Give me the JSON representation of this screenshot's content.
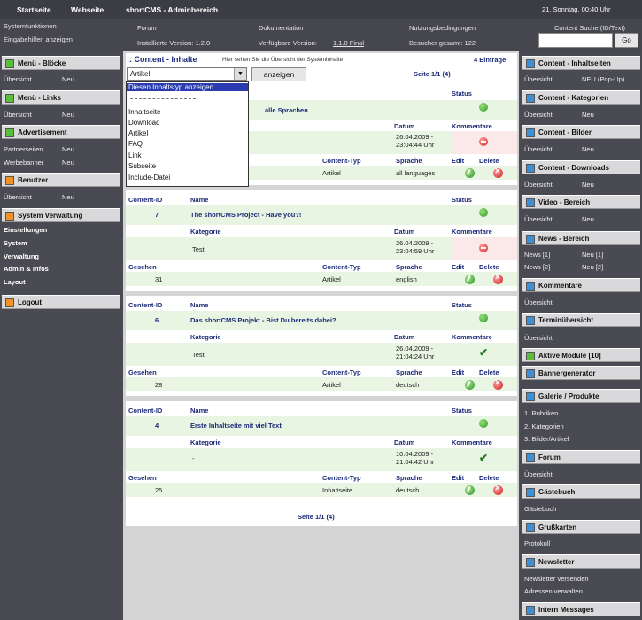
{
  "topbar": {
    "nav": [
      "Startseite",
      "Webseite"
    ],
    "title": "shortCMS - Adminbereich",
    "datetime": "21. Sonntag, 00:40 Uhr"
  },
  "subbar": {
    "systemfunktionen": "Systemfunktionen",
    "eingabehilfen": "Eingabehilfen anzeigen",
    "forum": "Forum",
    "installed_version": "Installierte Version: 1.2.0",
    "documentation": "Dokumentation",
    "available_version_label": "Verfügbare Version:",
    "available_version_value": "1.1.0 Final",
    "terms": "Nutzungsbedingungen",
    "visitors": "Besucher gesamt: 122",
    "search_label": "Content Suche (ID/Text)",
    "go": "Go"
  },
  "left_sidebar": {
    "blocks": [
      {
        "title": "Menü - Blöcke",
        "icon": "green-square-icon",
        "links": [
          "Übersicht",
          "Neu"
        ]
      },
      {
        "title": "Menü - Links",
        "icon": "green-square-icon",
        "links": [
          "Übersicht",
          "Neu"
        ]
      },
      {
        "title": "Advertisement",
        "icon": "green-square-icon",
        "links": [
          "Partnerseiten",
          "Neu",
          "Werbebanner",
          "Neu"
        ]
      },
      {
        "title": "Benutzer",
        "icon": "orange-square-icon",
        "links": [
          "Übersicht",
          "Neu"
        ]
      },
      {
        "title": "System Verwaltung",
        "icon": "orange-square-icon",
        "items": [
          "Einstellungen",
          "System",
          "Verwaltung",
          "Admin & Infos",
          "Layout"
        ]
      },
      {
        "title": "Logout",
        "icon": "orange-square-icon"
      }
    ]
  },
  "right_sidebar": {
    "blocks": [
      {
        "title": "Content - Inhaltseiten",
        "links": [
          "Übersicht",
          "NEU (Pop-Up)"
        ]
      },
      {
        "title": "Content - Kategorien",
        "links": [
          "Übersicht",
          "Neu"
        ]
      },
      {
        "title": "Content - Bilder",
        "links": [
          "Übersicht",
          "Neu"
        ]
      },
      {
        "title": "Content - Downloads",
        "links": [
          "Übersicht",
          "Neu"
        ]
      },
      {
        "title": "Video - Bereich",
        "links": [
          "Übersicht",
          "Neu"
        ]
      },
      {
        "title": "News - Bereich",
        "links": [
          "News [1]",
          "Neu [1]",
          "News [2]",
          "Neu [2]"
        ]
      },
      {
        "title": "Kommentare",
        "links": [
          "Übersicht"
        ]
      },
      {
        "title": "Terminübersicht",
        "links": [
          "Übersicht"
        ]
      },
      {
        "title": "Aktive Module [10]",
        "links": []
      },
      {
        "title": "Bannergenerator",
        "links": []
      },
      {
        "title": "Galerie / Produkte",
        "links": [
          "1. Rubriken",
          "2. Kategorien",
          "3. Bilder/Artikel"
        ]
      },
      {
        "title": "Forum",
        "links": [
          "Übersicht"
        ]
      },
      {
        "title": "Gästebuch",
        "links": [
          "Gästebuch"
        ]
      },
      {
        "title": "Grußkarten",
        "links": [
          "Protokoll"
        ]
      },
      {
        "title": "Newsletter",
        "links": [
          "Newsletter versenden",
          "Adressen verwalten"
        ]
      },
      {
        "title": "Intern Messages",
        "links": []
      }
    ]
  },
  "content": {
    "title": ":: Content - Inhalte",
    "subtitle": "Hier sehen Sie die Übersicht der Systeminhalte",
    "entries": "4 Einträge",
    "page_top": "Seite 1/1 (4)",
    "page_bottom": "Seite 1/1 (4)",
    "select_value": "Artikel",
    "show_button": "anzeigen",
    "dropdown_options": [
      "Diesen Inhaltstyp anzeigen",
      "Inhaltseite",
      "Download",
      "Artikel",
      "FAQ",
      "Link",
      "Subseite",
      "Include-Datei"
    ],
    "partial_name": "alle Sprachen",
    "headers": {
      "id": "Content-ID",
      "name": "Name",
      "status": "Status",
      "kategorie": "Kategorie",
      "datum": "Datum",
      "kommentare": "Kommentare",
      "gesehen": "Gesehen",
      "typ": "Content-Typ",
      "sprache": "Sprache",
      "edit": "Edit",
      "delete": "Delete"
    },
    "entries_list": [
      {
        "id": "",
        "name": "... alle Sprachen",
        "kategorie": "",
        "datum": "26.04.2009 - 23:04:44 Uhr",
        "gesehen": "",
        "typ": "Artikel",
        "sprache": "all languages",
        "comment_status": "off"
      },
      {
        "id": "7",
        "name": "The shortCMS Project - Have you?!",
        "kategorie": "Test",
        "datum": "26.04.2009 - 23:04:59 Uhr",
        "gesehen": "31",
        "typ": "Artikel",
        "sprache": "english",
        "comment_status": "off"
      },
      {
        "id": "6",
        "name": "Das shortCMS Projekt - Bist Du bereits dabei?",
        "kategorie": "Test",
        "datum": "26.04.2009 - 21:04:24 Uhr",
        "gesehen": "28",
        "typ": "Artikel",
        "sprache": "deutsch",
        "comment_status": "on"
      },
      {
        "id": "4",
        "name": "Erste Inhaltseite mit viel Text",
        "kategorie": "-",
        "datum": "10.04.2009 - 21:04:42 Uhr",
        "gesehen": "25",
        "typ": "Inhaltseite",
        "sprache": "deutsch",
        "comment_status": "on"
      }
    ]
  },
  "colors": {
    "bg": "#4a4a52",
    "header_text": "#1b2a78",
    "row_tint": "#e8f5e3",
    "select_highlight": "#2a3cb0"
  }
}
